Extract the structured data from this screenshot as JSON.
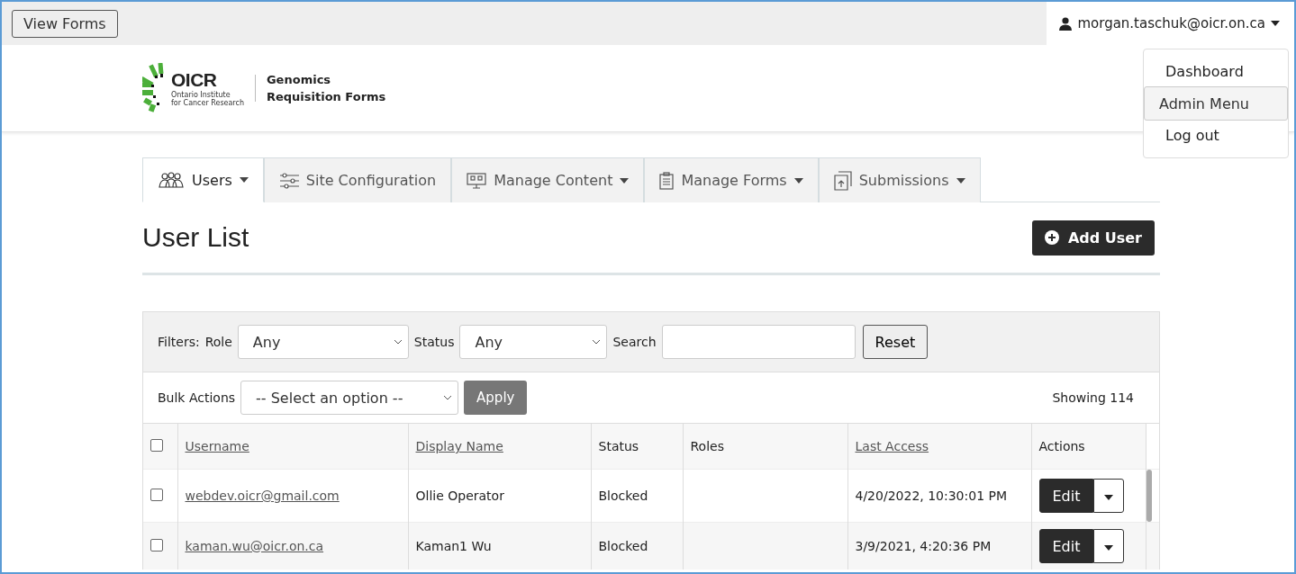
{
  "top_bar": {
    "view_forms_button": "View Forms",
    "user_menu": {
      "label": "morgan.taschuk@oicr.on.ca",
      "expanded": true,
      "items": [
        {
          "label": "Dashboard",
          "selected": false
        },
        {
          "label": "Admin Menu",
          "selected": true
        },
        {
          "label": "Log out",
          "selected": false
        }
      ]
    }
  },
  "logo": {
    "wordmark": "OICR",
    "subtitle_lines": [
      "Ontario Institute",
      "for Cancer Research"
    ],
    "site_title_lines": [
      "Genomics",
      "Requisition Forms"
    ]
  },
  "tabs": [
    {
      "label": "Users",
      "dropdown": true,
      "selected": true
    },
    {
      "label": "Site Configuration",
      "dropdown": false,
      "selected": false
    },
    {
      "label": "Manage Content",
      "dropdown": true,
      "selected": false
    },
    {
      "label": "Manage Forms",
      "dropdown": true,
      "selected": false
    },
    {
      "label": "Submissions",
      "dropdown": true,
      "selected": false
    }
  ],
  "page_title": "User List",
  "add_button": "Add User",
  "filters": {
    "label": "Filters:",
    "role_label": "Role",
    "role_value": "Any",
    "status_label": "Status",
    "status_value": "Any",
    "search_label": "Search",
    "reset_button": "Reset"
  },
  "bulk": {
    "label": "Bulk Actions",
    "select_value": "-- Select an option --",
    "apply_button": "Apply",
    "count": "Showing 114"
  },
  "table": {
    "columns": [
      {
        "label": "Username",
        "sortable": true
      },
      {
        "label": "Display Name",
        "sortable": true
      },
      {
        "label": "Status",
        "sortable": false
      },
      {
        "label": "Roles",
        "sortable": false
      },
      {
        "label": "Last Access",
        "sortable": true
      },
      {
        "label": "Actions",
        "sortable": false
      }
    ],
    "header_checked": false,
    "rows": [
      {
        "checked": false,
        "username": "webdev.oicr@gmail.com",
        "display_name": "Ollie Operator",
        "status": "Blocked",
        "roles": "",
        "last_access": "4/20/2022, 10:30:01 PM",
        "edit_label": "Edit"
      },
      {
        "checked": false,
        "username": "kaman.wu@oicr.on.ca",
        "display_name": "Kaman1 Wu",
        "status": "Blocked",
        "roles": "",
        "last_access": "3/9/2021, 4:20:36 PM",
        "edit_label": "Edit"
      }
    ]
  }
}
